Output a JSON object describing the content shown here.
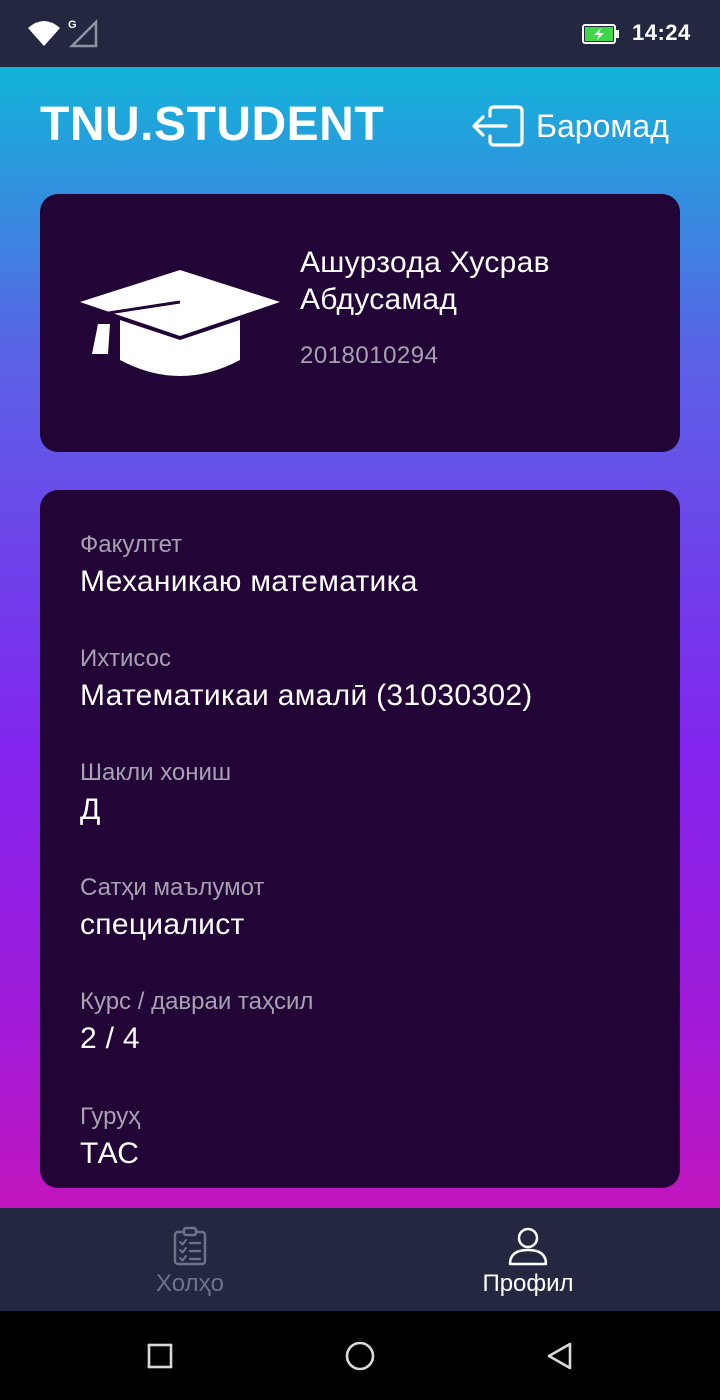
{
  "status_bar": {
    "network_label": "G",
    "time": "14:24"
  },
  "header": {
    "app_title": "TNU.STUDENT",
    "logout_label": "Баромад"
  },
  "profile": {
    "name": "Ашурзода Хусрав Абдусамад",
    "student_id": "2018010294"
  },
  "info": [
    {
      "label": "Факултет",
      "value": "Механикаю математика"
    },
    {
      "label": "Ихтисос",
      "value": "Математикаи амалӣ (31030302)"
    },
    {
      "label": "Шакли хониш",
      "value": "Д"
    },
    {
      "label": "Сатҳи маълумот",
      "value": "специалист"
    },
    {
      "label": "Курс / давраи таҳсил",
      "value": "2 / 4"
    },
    {
      "label": "Гуруҳ",
      "value": "ТАС"
    }
  ],
  "bottom_nav": {
    "tasks_label": "Холҳо",
    "profile_label": "Профил",
    "active": "profile"
  },
  "colors": {
    "card_background": "#220536",
    "bar_background": "#232840",
    "label_gray": "#a8a1b2",
    "battery_green": "#3fd64a"
  },
  "icons": [
    "wifi-icon",
    "signal-icon",
    "battery-icon",
    "logout-icon",
    "graduation-cap-icon",
    "clipboard-checklist-icon",
    "user-icon",
    "recent-apps-icon",
    "home-icon",
    "back-icon"
  ]
}
